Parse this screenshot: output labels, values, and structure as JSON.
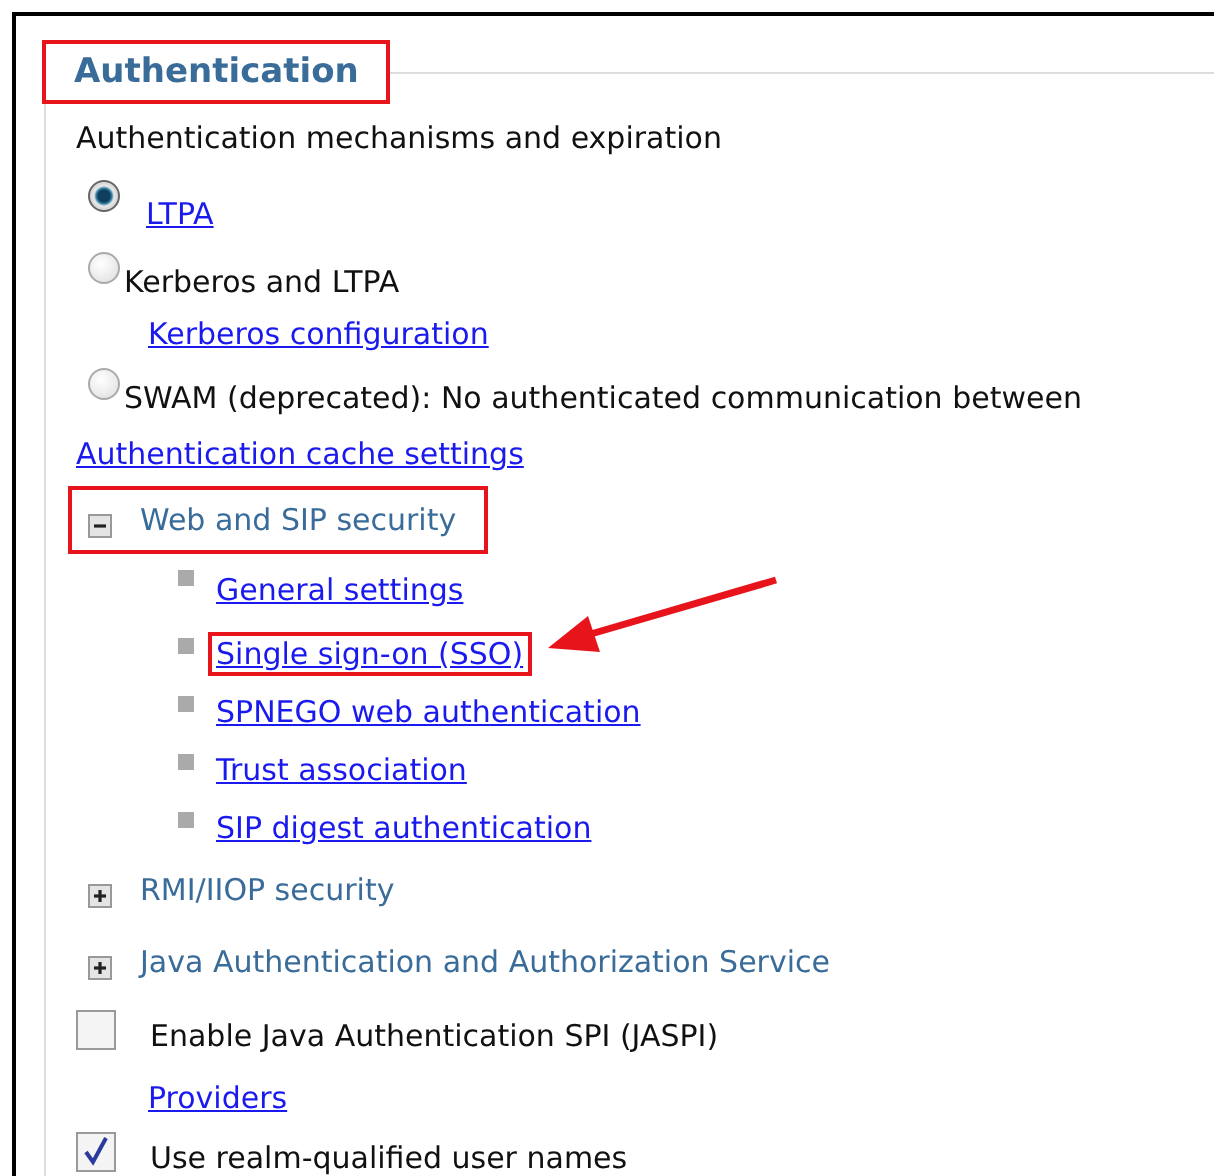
{
  "section": {
    "title": "Authentication",
    "highlighted": true
  },
  "subtitle": "Authentication mechanisms and expiration",
  "mechanisms": [
    {
      "label": "LTPA",
      "selected": true,
      "kind": "link"
    },
    {
      "label": "Kerberos and LTPA",
      "selected": false,
      "kind": "text",
      "sublink": "Kerberos configuration"
    },
    {
      "label": "SWAM (deprecated): No authenticated communication between",
      "selected": false,
      "kind": "text"
    }
  ],
  "cache_link": "Authentication cache settings",
  "groups": [
    {
      "title": "Web and SIP security",
      "expanded": true,
      "highlighted": true,
      "children": [
        {
          "label": "General settings",
          "highlighted": false,
          "arrow": false
        },
        {
          "label": "Single sign-on (SSO)",
          "highlighted": true,
          "arrow": true
        },
        {
          "label": "SPNEGO web authentication",
          "highlighted": false,
          "arrow": false
        },
        {
          "label": "Trust association",
          "highlighted": false,
          "arrow": false
        },
        {
          "label": "SIP digest authentication",
          "highlighted": false,
          "arrow": false
        }
      ]
    },
    {
      "title": "RMI/IIOP security",
      "expanded": false,
      "highlighted": false
    },
    {
      "title": "Java Authentication and Authorization Service",
      "expanded": false,
      "highlighted": false
    }
  ],
  "options": [
    {
      "label": "Enable Java Authentication SPI (JASPI)",
      "checked": false,
      "link": "Providers"
    },
    {
      "label": "Use realm-qualified user names",
      "checked": true
    }
  ]
}
